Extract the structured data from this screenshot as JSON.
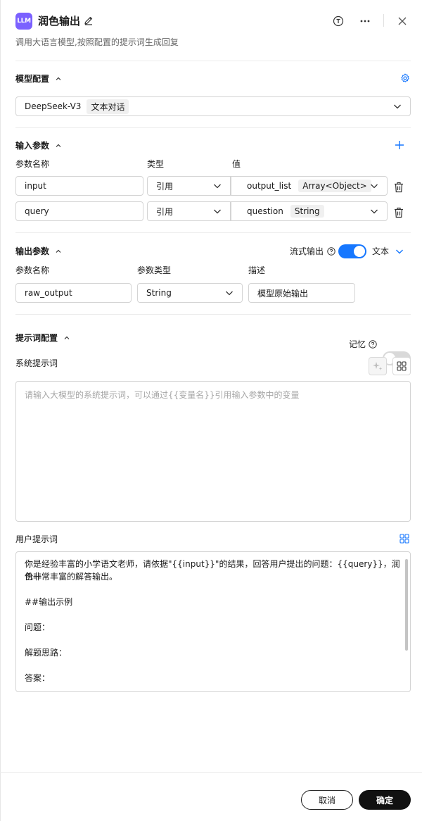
{
  "header": {
    "logo_text": "LLM",
    "title": "润色输出",
    "description": "调用大语言模型,按照配置的提示词生成回复"
  },
  "model_config": {
    "title": "模型配置",
    "model_name": "DeepSeek-V3",
    "model_tag": "文本对话"
  },
  "input_params": {
    "title": "输入参数",
    "columns": [
      "参数名称",
      "类型",
      "值"
    ],
    "rows": [
      {
        "name": "input",
        "type": "引用",
        "value": "output_list",
        "value_type": "Array<Object>"
      },
      {
        "name": "query",
        "type": "引用",
        "value": "question",
        "value_type": "String"
      }
    ]
  },
  "output_params": {
    "title": "输出参数",
    "stream_label": "流式输出",
    "stream_enabled": true,
    "format": "文本",
    "columns": [
      "参数名称",
      "参数类型",
      "描述"
    ],
    "row": {
      "name": "raw_output",
      "type": "String",
      "description": "模型原始输出"
    }
  },
  "prompt_config": {
    "title": "提示词配置",
    "memory_label": "记忆",
    "memory_enabled": false,
    "system_prompt_label": "系统提示词",
    "system_prompt_placeholder": "请输入大模型的系统提示词，可以通过{{变量名}}引用输入参数中的变量",
    "user_prompt_label": "用户提示词",
    "user_prompt_lines": [
      "你是经验丰富的小学语文老师，请依据\"{{input}}\"的结果，回答用户提出的问题：{{query}}，润色一",
      "份非常丰富的解答输出。",
      "",
      "##输出示例",
      "",
      "问题：",
      "",
      "解题思路：",
      "",
      "答案："
    ]
  },
  "footer": {
    "cancel_label": "取消",
    "confirm_label": "确定"
  },
  "colors": {
    "accent": "#1677ff",
    "logo": "#7b61ff",
    "primary_button": "#111111"
  }
}
